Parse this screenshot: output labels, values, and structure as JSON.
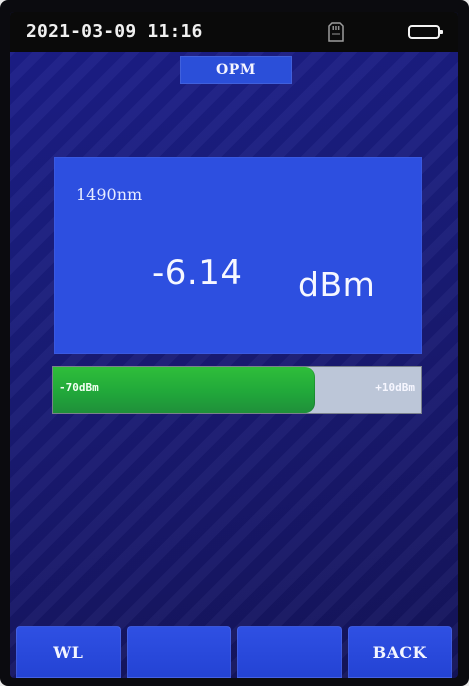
{
  "status_bar": {
    "datetime": "2021-03-09 11:16",
    "icons": {
      "storage": "sd-card-icon",
      "battery": "battery-icon"
    }
  },
  "header": {
    "mode": "OPM"
  },
  "reading": {
    "wavelength": "1490nm",
    "value": "-6.14",
    "unit": "dBm"
  },
  "meter": {
    "min_label": "-70dBm",
    "max_label": "+10dBm",
    "fill_percent": 71,
    "fill_color": "#23b03a"
  },
  "softkeys": [
    {
      "label": "WL"
    },
    {
      "label": ""
    },
    {
      "label": ""
    },
    {
      "label": "BACK"
    }
  ],
  "colors": {
    "panel_blue": "#2d4fe0",
    "background_blue": "#1b1d89",
    "softkey_blue": "#2f50e3",
    "status_black": "#0a0a0a"
  }
}
